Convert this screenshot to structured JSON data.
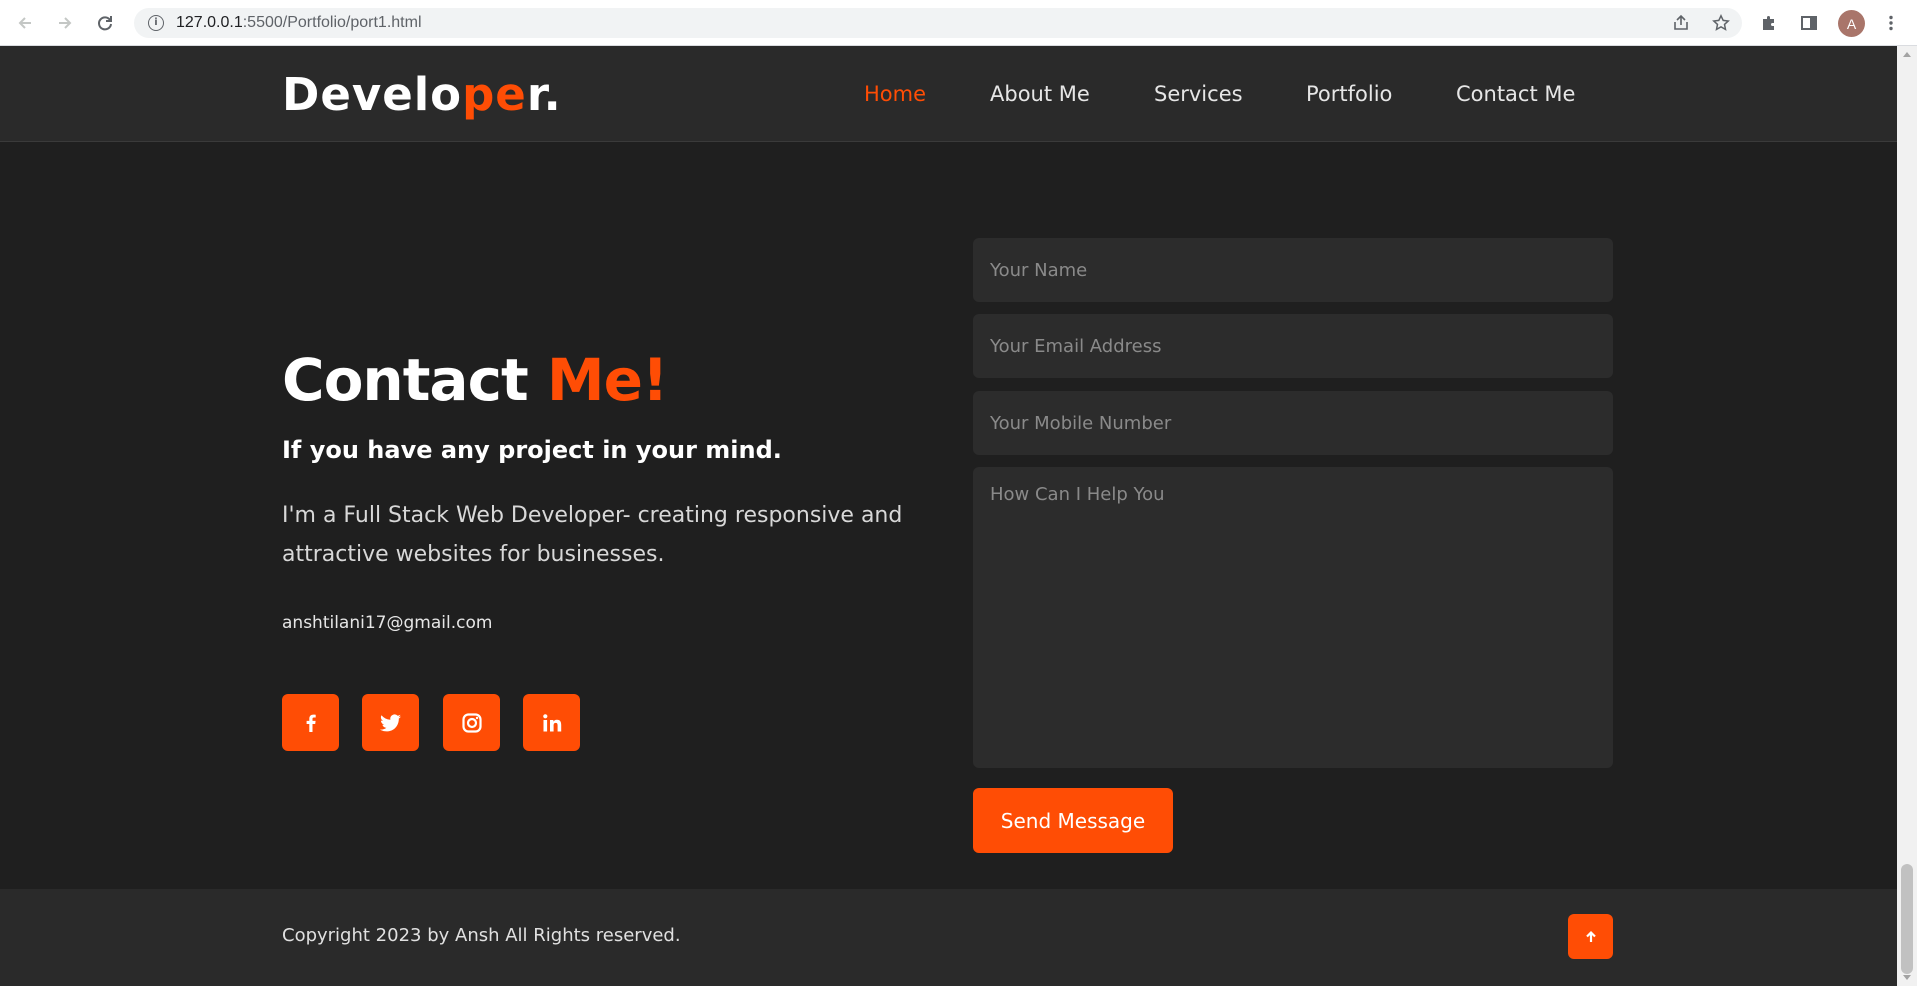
{
  "browser": {
    "url_host": "127.0.0.1",
    "url_path": ":5500/Portfolio/port1.html",
    "profile_initial": "A",
    "icons": {
      "back": "arrow-left-icon",
      "forward": "arrow-right-icon",
      "reload": "reload-icon",
      "info": "info-icon",
      "share": "share-icon",
      "bookmark": "star-icon",
      "extensions": "puzzle-icon",
      "sidepanel": "side-panel-icon",
      "menu": "kebab-menu-icon"
    }
  },
  "header": {
    "logo_part1": "Develo",
    "logo_accent": "pe",
    "logo_part2": "r.",
    "nav": [
      {
        "label": "Home",
        "active": true
      },
      {
        "label": "About Me",
        "active": false
      },
      {
        "label": "Services",
        "active": false
      },
      {
        "label": "Portfolio",
        "active": false
      },
      {
        "label": "Contact Me",
        "active": false
      }
    ]
  },
  "contact": {
    "title": "Contact",
    "title_accent": "Me!",
    "subtitle": "If you have any project in your mind.",
    "description": "I'm a Full Stack Web Developer- creating responsive and attractive websites for businesses.",
    "email": "anshtilani17@gmail.com",
    "social": [
      {
        "name": "facebook",
        "glyph": "f"
      },
      {
        "name": "twitter",
        "glyph": "twitter"
      },
      {
        "name": "instagram",
        "glyph": "instagram"
      },
      {
        "name": "linkedin",
        "glyph": "in"
      }
    ]
  },
  "form": {
    "name_placeholder": "Your Name",
    "email_placeholder": "Your Email Address",
    "mobile_placeholder": "Your Mobile Number",
    "message_placeholder": "How Can I Help You",
    "submit_label": "Send Message"
  },
  "footer": {
    "copyright": "Copyright 2023 by Ansh All Rights reserved.",
    "top_icon": "arrow-up-icon"
  },
  "colors": {
    "accent": "#ff4d05",
    "background": "#1f1f1f",
    "header_bg": "#2a2a2a",
    "field_bg": "#2c2c2c"
  }
}
